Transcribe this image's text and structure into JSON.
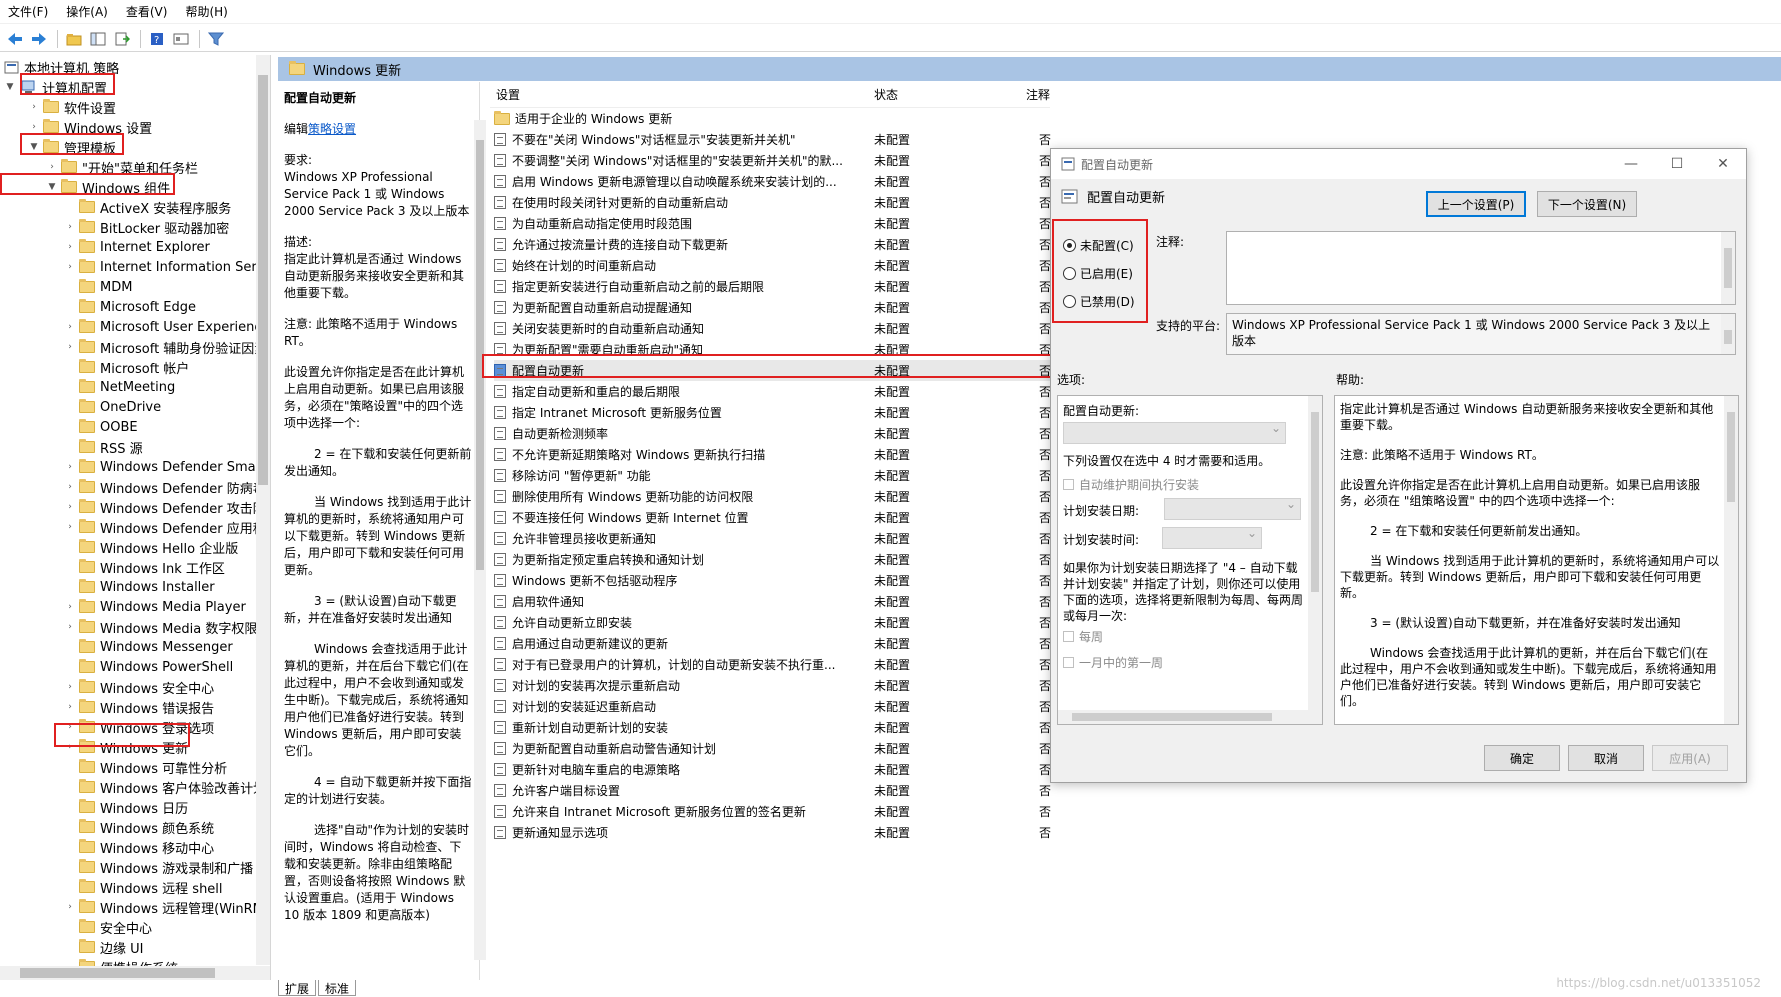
{
  "menubar": [
    "文件(F)",
    "操作(A)",
    "查看(V)",
    "帮助(H)"
  ],
  "tree": {
    "root": "本地计算机 策略",
    "computer_config": "计算机配置",
    "software_settings": "软件设置",
    "windows_settings": "Windows 设置",
    "admin_templates": "管理模板",
    "start_menu": "\"开始\"菜单和任务栏",
    "windows_components": "Windows 组件",
    "items": [
      "ActiveX 安装程序服务",
      "BitLocker 驱动器加密",
      "Internet Explorer",
      "Internet Information Servic",
      "MDM",
      "Microsoft Edge",
      "Microsoft User Experience",
      "Microsoft 辅助身份验证因素",
      "Microsoft 帐户",
      "NetMeeting",
      "OneDrive",
      "OOBE",
      "RSS 源",
      "Windows Defender SmartS",
      "Windows Defender 防病毒",
      "Windows Defender 攻击防",
      "Windows Defender 应用程",
      "Windows Hello 企业版",
      "Windows Ink 工作区",
      "Windows Installer",
      "Windows Media Player",
      "Windows Media 数字权限管",
      "Windows Messenger",
      "Windows PowerShell",
      "Windows 安全中心",
      "Windows 错误报告",
      "Windows 登录选项",
      "Windows 更新",
      "Windows 可靠性分析",
      "Windows 客户体验改善计划",
      "Windows 日历",
      "Windows 颜色系统",
      "Windows 移动中心",
      "Windows 游戏录制和广播",
      "Windows 远程 shell",
      "Windows 远程管理(WinRM)",
      "安全中心",
      "边缘 UI",
      "便携操作系统"
    ]
  },
  "panel_title": "Windows 更新",
  "desc": {
    "title": "配置自动更新",
    "edit_prefix": "编辑",
    "edit_link": "策略设置",
    "req_label": "要求:",
    "req_text": "Windows XP Professional Service Pack 1 或 Windows 2000 Service Pack 3 及以上版本",
    "desc_label": "描述:",
    "p1": "指定此计算机是否通过 Windows 自动更新服务来接收安全更新和其他重要下载。",
    "p2": "注意: 此策略不适用于 Windows RT。",
    "p3": "此设置允许你指定是否在此计算机上启用自动更新。如果已启用该服务，必须在\"策略设置\"中的四个选项中选择一个:",
    "p4": "2 = 在下载和安装任何更新前发出通知。",
    "p5": "当 Windows 找到适用于此计算机的更新时，系统将通知用户可以下载更新。转到 Windows 更新后，用户即可下载和安装任何可用更新。",
    "p6": "3 = (默认设置)自动下载更新，并在准备好安装时发出通知",
    "p7": "Windows 会查找适用于此计算机的更新，并在后台下载它们(在此过程中，用户不会收到通知或发生中断)。下载完成后，系统将通知用户他们已准备好进行安装。转到 Windows 更新后，用户即可安装它们。",
    "p8": "4 = 自动下载更新并按下面指定的计划进行安装。",
    "p9": "选择\"自动\"作为计划的安装时间时，Windows 将自动检查、下载和安装更新。除非由组策略配置，否则设备将按照 Windows 默认设置重启。(适用于 Windows 10 版本 1809 和更高版本)"
  },
  "tabs": [
    "扩展",
    "标准"
  ],
  "list": {
    "col_setting": "设置",
    "col_state": "状态",
    "col_note": "注释",
    "folder_row": "适用于企业的 Windows 更新",
    "rows": [
      {
        "name": "不要在\"关闭 Windows\"对话框显示\"安装更新并关机\"",
        "state": "未配置",
        "note": "否"
      },
      {
        "name": "不要调整\"关闭 Windows\"对话框里的\"安装更新并关机\"的默...",
        "state": "未配置",
        "note": "否"
      },
      {
        "name": "启用 Windows 更新电源管理以自动唤醒系统来安装计划的...",
        "state": "未配置",
        "note": "否"
      },
      {
        "name": "在使用时段关闭针对更新的自动重新启动",
        "state": "未配置",
        "note": "否"
      },
      {
        "name": "为自动重新启动指定使用时段范围",
        "state": "未配置",
        "note": "否"
      },
      {
        "name": "允许通过按流量计费的连接自动下载更新",
        "state": "未配置",
        "note": "否"
      },
      {
        "name": "始终在计划的时间重新启动",
        "state": "未配置",
        "note": "否"
      },
      {
        "name": "指定更新安装进行自动重新启动之前的最后期限",
        "state": "未配置",
        "note": "否"
      },
      {
        "name": "为更新配置自动重新启动提醒通知",
        "state": "未配置",
        "note": "否"
      },
      {
        "name": "关闭安装更新时的自动重新启动通知",
        "state": "未配置",
        "note": "否"
      },
      {
        "name": "为更新配置\"需要自动重新启动\"通知",
        "state": "未配置",
        "note": "否"
      },
      {
        "name": "配置自动更新",
        "state": "未配置",
        "note": "否"
      },
      {
        "name": "指定自动更新和重启的最后期限",
        "state": "未配置",
        "note": "否"
      },
      {
        "name": "指定 Intranet Microsoft 更新服务位置",
        "state": "未配置",
        "note": "否"
      },
      {
        "name": "自动更新检测频率",
        "state": "未配置",
        "note": "否"
      },
      {
        "name": "不允许更新延期策略对 Windows 更新执行扫描",
        "state": "未配置",
        "note": "否"
      },
      {
        "name": "移除访问 \"暂停更新\" 功能",
        "state": "未配置",
        "note": "否"
      },
      {
        "name": "删除使用所有 Windows 更新功能的访问权限",
        "state": "未配置",
        "note": "否"
      },
      {
        "name": "不要连接任何 Windows 更新 Internet 位置",
        "state": "未配置",
        "note": "否"
      },
      {
        "name": "允许非管理员接收更新通知",
        "state": "未配置",
        "note": "否"
      },
      {
        "name": "为更新指定预定重启转换和通知计划",
        "state": "未配置",
        "note": "否"
      },
      {
        "name": "Windows 更新不包括驱动程序",
        "state": "未配置",
        "note": "否"
      },
      {
        "name": "启用软件通知",
        "state": "未配置",
        "note": "否"
      },
      {
        "name": "允许自动更新立即安装",
        "state": "未配置",
        "note": "否"
      },
      {
        "name": "启用通过自动更新建议的更新",
        "state": "未配置",
        "note": "否"
      },
      {
        "name": "对于有已登录用户的计算机，计划的自动更新安装不执行重...",
        "state": "未配置",
        "note": "否"
      },
      {
        "name": "对计划的安装再次提示重新启动",
        "state": "未配置",
        "note": "否"
      },
      {
        "name": "对计划的安装延迟重新启动",
        "state": "未配置",
        "note": "否"
      },
      {
        "name": "重新计划自动更新计划的安装",
        "state": "未配置",
        "note": "否"
      },
      {
        "name": "为更新配置自动重新启动警告通知计划",
        "state": "未配置",
        "note": "否"
      },
      {
        "name": "更新针对电脑车重启的电源策略",
        "state": "未配置",
        "note": "否"
      },
      {
        "name": "允许客户端目标设置",
        "state": "未配置",
        "note": "否"
      },
      {
        "name": "允许来自 Intranet Microsoft 更新服务位置的签名更新",
        "state": "未配置",
        "note": "否"
      },
      {
        "name": "更新通知显示选项",
        "state": "未配置",
        "note": "否"
      }
    ]
  },
  "dialog": {
    "title": "配置自动更新",
    "heading": "配置自动更新",
    "prev_btn": "上一个设置(P)",
    "next_btn": "下一个设置(N)",
    "radio_not_configured": "未配置(C)",
    "radio_enabled": "已启用(E)",
    "radio_disabled": "已禁用(D)",
    "comment_label": "注释:",
    "platform_label": "支持的平台:",
    "platform_text": "Windows XP Professional Service Pack 1 或 Windows 2000 Service Pack 3 及以上版本",
    "options_label": "选项:",
    "help_label": "帮助:",
    "opt_config_label": "配置自动更新:",
    "opt_note": "下列设置仅在选中 4 时才需要和适用。",
    "opt_maint": "自动维护期间执行安装",
    "opt_day": "计划安装日期:",
    "opt_time": "计划安装时间:",
    "opt_para": "如果你为计划安装日期选择了 \"4 – 自动下载并计划安装\" 并指定了计划，则你还可以使用下面的选项，选择将更新限制为每周、每两周或每月一次:",
    "opt_weekly": "每周",
    "opt_firstweek": "一月中的第一周",
    "help_p1": "指定此计算机是否通过 Windows 自动更新服务来接收安全更新和其他重要下载。",
    "help_p2": "注意: 此策略不适用于 Windows RT。",
    "help_p3": "此设置允许你指定是否在此计算机上启用自动更新。如果已启用该服务，必须在 \"组策略设置\" 中的四个选项中选择一个:",
    "help_p4": "2 = 在下载和安装任何更新前发出通知。",
    "help_p5": "当 Windows 找到适用于此计算机的更新时，系统将通知用户可以下载更新。转到 Windows 更新后，用户即可下载和安装任何可用更新。",
    "help_p6": "3 = (默认设置)自动下载更新，并在准备好安装时发出通知",
    "help_p7": "Windows 会查找适用于此计算机的更新，并在后台下载它们(在此过程中，用户不会收到通知或发生中断)。下载完成后，系统将通知用户他们已准备好进行安装。转到 Windows 更新后，用户即可安装它们。",
    "ok": "确定",
    "cancel": "取消",
    "apply": "应用(A)"
  },
  "watermark": "https://blog.csdn.net/u013351052"
}
